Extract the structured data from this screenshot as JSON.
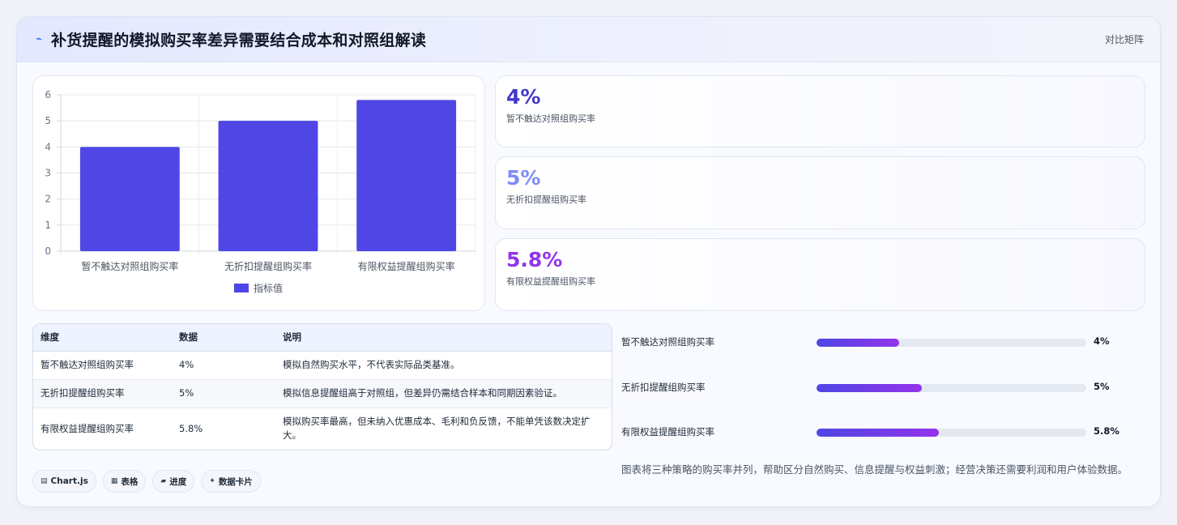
{
  "header": {
    "icon": "sparkline-icon",
    "title": "补货提醒的模拟购买率差异需要结合成本和对照组解读",
    "badge": "对比矩阵"
  },
  "chart_data": {
    "type": "bar",
    "categories": [
      "暂不触达对照组购买率",
      "无折扣提醒组购买率",
      "有限权益提醒组购买率"
    ],
    "series": [
      {
        "name": "指标值",
        "values": [
          4,
          5,
          5.8
        ],
        "color": "#4f46e5"
      }
    ],
    "ylim": [
      0,
      6
    ],
    "yticks": [
      "0",
      "1",
      "2",
      "3",
      "4",
      "5",
      "6"
    ],
    "grid": true,
    "legend": "bottom"
  },
  "kpis": [
    {
      "value": "4%",
      "label": "暂不触达对照组购买率",
      "color": "#4338ca"
    },
    {
      "value": "5%",
      "label": "无折扣提醒组购买率",
      "color": "#818cf8"
    },
    {
      "value": "5.8%",
      "label": "有限权益提醒组购买率",
      "color": "#9333ea"
    }
  ],
  "table": {
    "headers": [
      "维度",
      "数据",
      "说明"
    ],
    "rows": [
      [
        "暂不触达对照组购买率",
        "4%",
        "模拟自然购买水平，不代表实际品类基准。"
      ],
      [
        "无折扣提醒组购买率",
        "5%",
        "模拟信息提醒组高于对照组，但差异仍需结合样本和同期因素验证。"
      ],
      [
        "有限权益提醒组购买率",
        "5.8%",
        "模拟购买率最高，但未纳入优惠成本、毛利和负反馈，不能单凭该数决定扩大。"
      ]
    ]
  },
  "progress": [
    {
      "label": "暂不触达对照组购买率",
      "value": "4%",
      "fraction": 0.307
    },
    {
      "label": "无折扣提醒组购买率",
      "value": "5%",
      "fraction": 0.389
    },
    {
      "label": "有限权益提醒组购买率",
      "value": "5.8%",
      "fraction": 0.452
    }
  ],
  "note": "图表将三种策略的购买率并列，帮助区分自然购买、信息提醒与权益刺激；经营决策还需要利润和用户体验数据。",
  "tags": [
    {
      "icon": "chart-icon",
      "glyph": "▤",
      "label": "Chart.js"
    },
    {
      "icon": "table-icon",
      "glyph": "▦",
      "label": "表格"
    },
    {
      "icon": "progress-icon",
      "glyph": "▰",
      "label": "进度"
    },
    {
      "icon": "sparkle-icon",
      "glyph": "✦",
      "label": "数据卡片"
    }
  ]
}
